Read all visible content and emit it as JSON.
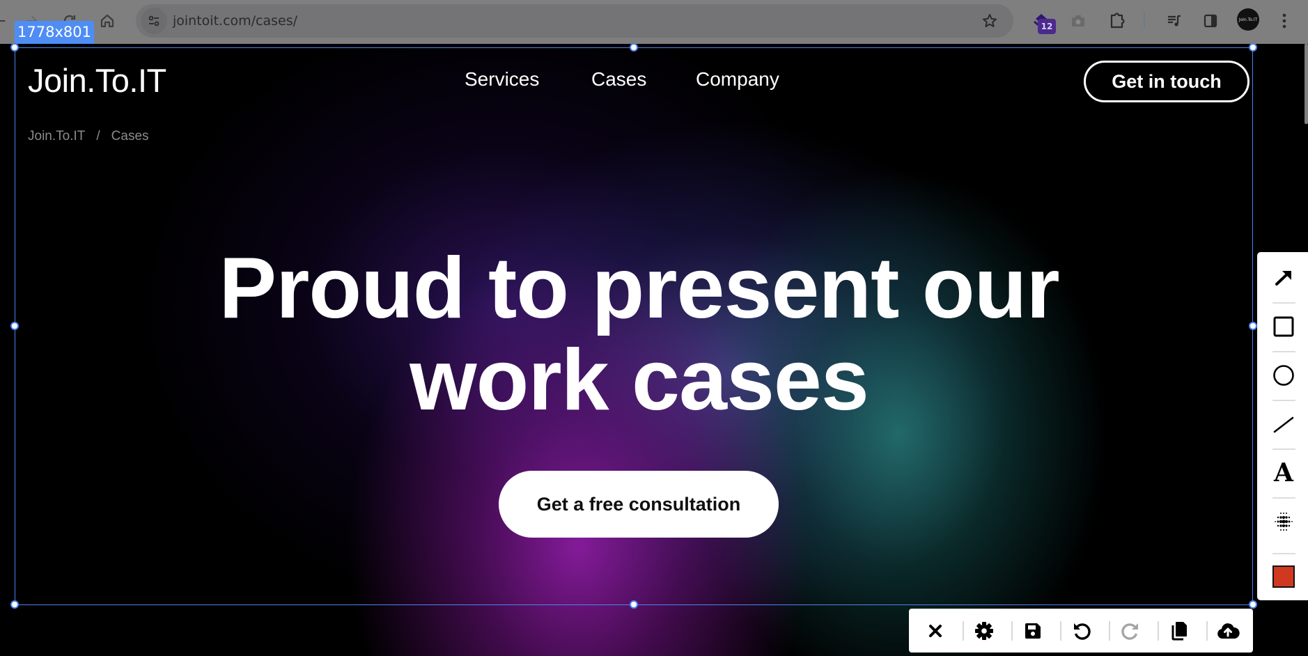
{
  "browser": {
    "url": "jointoit.com/cases/",
    "extension_badge": "12",
    "profile_label": "Join.To.IT",
    "icons": [
      "back-icon",
      "forward-icon",
      "reload-icon",
      "home-icon",
      "site-settings-icon",
      "bookmark-star-icon",
      "extension-icon",
      "camera-icon",
      "extensions-puzzle-icon",
      "media-control-icon",
      "side-panel-icon",
      "profile-avatar",
      "menu-kebab-icon"
    ]
  },
  "page": {
    "logo": "Join.To.IT",
    "nav": [
      {
        "label": "Services"
      },
      {
        "label": "Cases"
      },
      {
        "label": "Company"
      }
    ],
    "cta_header": "Get in touch",
    "breadcrumb": {
      "home": "Join.To.IT",
      "separator": "/",
      "current": "Cases"
    },
    "hero": {
      "line1": "Proud to present our",
      "line2": "work cases",
      "cta": "Get a free consultation"
    },
    "colors": {
      "background": "#000000",
      "gradient_purple": "#8a1ca0",
      "gradient_teal": "#236e6e",
      "gradient_indigo": "#5050a0",
      "text": "#ffffff",
      "breadcrumb_text": "#8b8b8b"
    }
  },
  "capture_tool": {
    "selection_size": "1778x801",
    "selection_color": "#4c84f0",
    "annotation_tools": [
      {
        "name": "arrow",
        "icon": "arrow-icon"
      },
      {
        "name": "rectangle",
        "icon": "rectangle-icon"
      },
      {
        "name": "ellipse",
        "icon": "circle-icon"
      },
      {
        "name": "line",
        "icon": "line-icon"
      },
      {
        "name": "text",
        "icon": "text-icon",
        "glyph": "A"
      },
      {
        "name": "blur",
        "icon": "blur-icon"
      },
      {
        "name": "color",
        "icon": "color-swatch",
        "value": "#d0391f"
      }
    ],
    "actions": [
      {
        "name": "close",
        "icon": "close-icon"
      },
      {
        "name": "settings",
        "icon": "gear-icon"
      },
      {
        "name": "save",
        "icon": "save-icon"
      },
      {
        "name": "undo",
        "icon": "undo-icon"
      },
      {
        "name": "redo",
        "icon": "redo-icon",
        "disabled": true
      },
      {
        "name": "copy",
        "icon": "copy-icon"
      },
      {
        "name": "upload",
        "icon": "cloud-upload-icon"
      }
    ]
  }
}
